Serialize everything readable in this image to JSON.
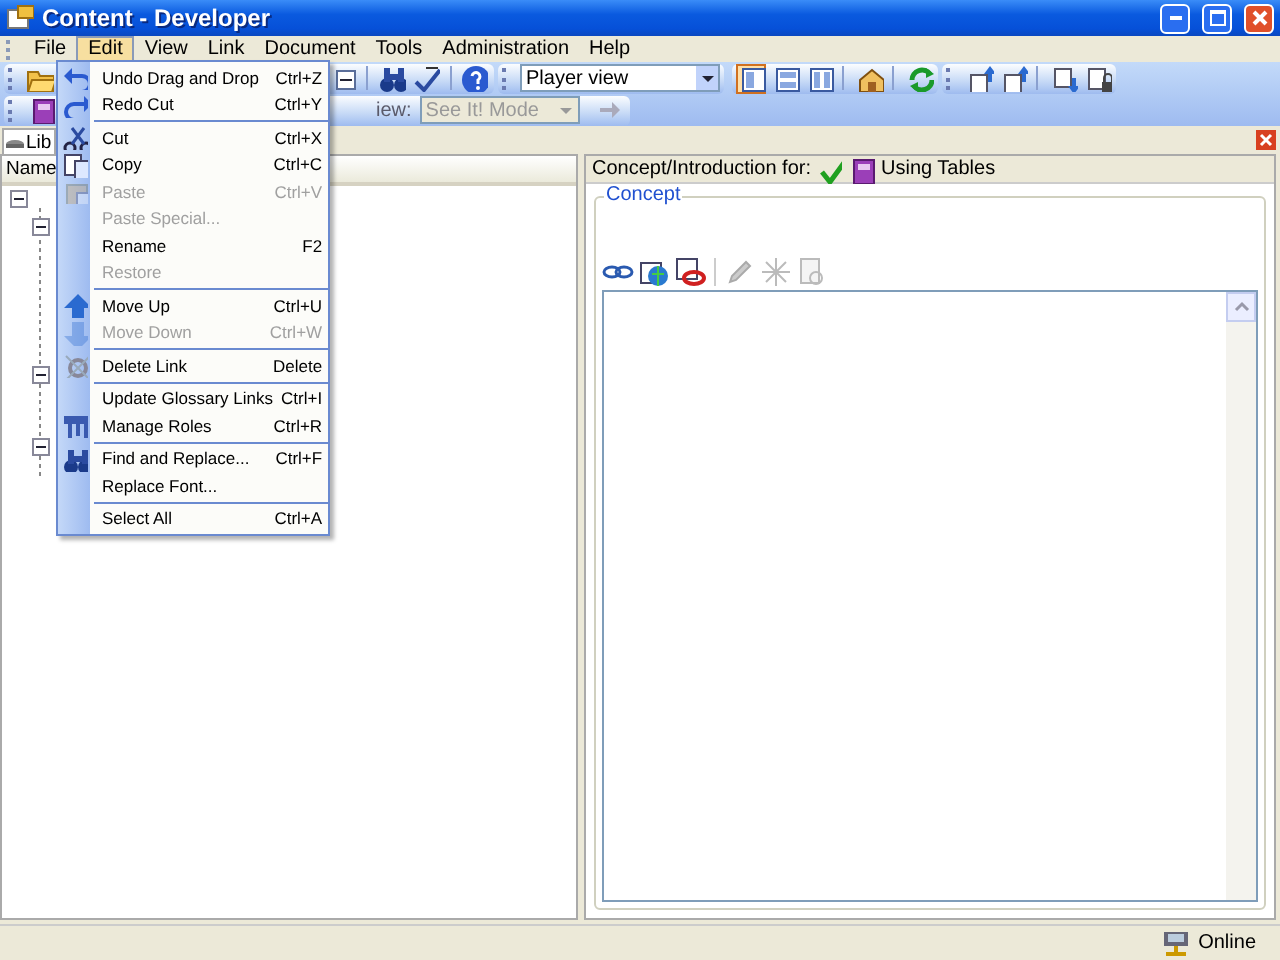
{
  "window": {
    "title": "Content - Developer"
  },
  "menubar": [
    {
      "label": "File",
      "selected": false
    },
    {
      "label": "Edit",
      "selected": true
    },
    {
      "label": "View",
      "selected": false
    },
    {
      "label": "Link",
      "selected": false
    },
    {
      "label": "Document",
      "selected": false
    },
    {
      "label": "Tools",
      "selected": false
    },
    {
      "label": "Administration",
      "selected": false
    },
    {
      "label": "Help",
      "selected": false
    }
  ],
  "toolbar": {
    "view_dropdown": {
      "value": "Player view"
    },
    "layout_buttons": [
      {
        "selected": true
      },
      {
        "selected": false
      },
      {
        "selected": false
      }
    ]
  },
  "toolbar2": {
    "label": "iew:",
    "mode_dropdown": {
      "value": "See It! Mode",
      "disabled": true
    }
  },
  "panel_tabs": [
    {
      "label": "Lib"
    }
  ],
  "outline": {
    "column": "Name"
  },
  "concept_panel": {
    "header_label": "Concept/Introduction for:",
    "document_title": "Using Tables",
    "group_title": "Concept"
  },
  "edit_menu": [
    {
      "kind": "item",
      "label": "Undo Drag and Drop",
      "shortcut": "Ctrl+Z",
      "disabled": false
    },
    {
      "kind": "item",
      "label": "Redo Cut",
      "shortcut": "Ctrl+Y",
      "disabled": false
    },
    {
      "kind": "separator"
    },
    {
      "kind": "item",
      "label": "Cut",
      "shortcut": "Ctrl+X",
      "disabled": false
    },
    {
      "kind": "item",
      "label": "Copy",
      "shortcut": "Ctrl+C",
      "disabled": false
    },
    {
      "kind": "item",
      "label": "Paste",
      "shortcut": "Ctrl+V",
      "disabled": true
    },
    {
      "kind": "item",
      "label": "Paste Special...",
      "disabled": true
    },
    {
      "kind": "item",
      "label": "Rename",
      "shortcut": "F2",
      "disabled": false
    },
    {
      "kind": "item",
      "label": "Restore",
      "disabled": true
    },
    {
      "kind": "separator"
    },
    {
      "kind": "item",
      "label": "Move Up",
      "shortcut": "Ctrl+U",
      "disabled": false
    },
    {
      "kind": "item",
      "label": "Move Down",
      "shortcut": "Ctrl+W",
      "disabled": true
    },
    {
      "kind": "separator"
    },
    {
      "kind": "item",
      "label": "Delete Link",
      "shortcut": "Delete",
      "disabled": false
    },
    {
      "kind": "separator"
    },
    {
      "kind": "item",
      "label": "Update Glossary Links",
      "shortcut": "Ctrl+I",
      "disabled": false
    },
    {
      "kind": "item",
      "label": "Manage Roles",
      "shortcut": "Ctrl+R",
      "disabled": false
    },
    {
      "kind": "separator"
    },
    {
      "kind": "item",
      "label": "Find and Replace...",
      "shortcut": "Ctrl+F",
      "disabled": false
    },
    {
      "kind": "item",
      "label": "Replace Font...",
      "disabled": false
    },
    {
      "kind": "separator"
    },
    {
      "kind": "item",
      "label": "Select All",
      "shortcut": "Ctrl+A",
      "disabled": false
    }
  ],
  "status_bar": {
    "status": "Online"
  }
}
